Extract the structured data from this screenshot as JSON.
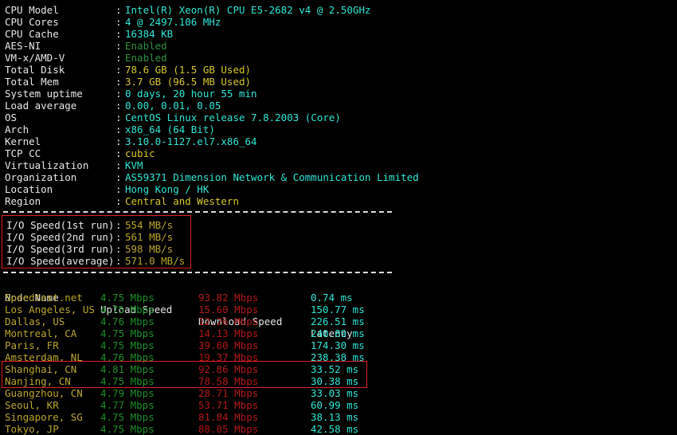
{
  "colors": {
    "background": "#000000",
    "cyan": "#2ee6d6",
    "green": "#3ddc84",
    "dim_green": "#2f8f3f",
    "yellow": "#d6c72b",
    "olive": "#b9a62b",
    "white": "#e8e8e8",
    "red": "#b01818",
    "annotation_red": "#e02020"
  },
  "sysinfo": {
    "rows": [
      {
        "label": "CPU Model",
        "value": "Intel(R) Xeon(R) CPU E5-2682 v4 @ 2.50GHz",
        "color": "c-cyan"
      },
      {
        "label": "CPU Cores",
        "value": "4 @ 2497.106 MHz",
        "color": "c-cyan"
      },
      {
        "label": "CPU Cache",
        "value": "16384 KB",
        "color": "c-cyan"
      },
      {
        "label": "AES-NI",
        "value": "Enabled",
        "color": "c-dimgreen"
      },
      {
        "label": "VM-x/AMD-V",
        "value": "Enabled",
        "color": "c-dimgreen"
      },
      {
        "label": "Total Disk",
        "value": "78.6 GB (1.5 GB Used)",
        "color": "c-yellow"
      },
      {
        "label": "Total Mem",
        "value": "3.7 GB (96.5 MB Used)",
        "color": "c-yellow"
      },
      {
        "label": "System uptime",
        "value": "0 days, 20 hour 55 min",
        "color": "c-cyan"
      },
      {
        "label": "Load average",
        "value": "0.00, 0.01, 0.05",
        "color": "c-cyan"
      },
      {
        "label": "OS",
        "value": "CentOS Linux release 7.8.2003 (Core)",
        "color": "c-cyan"
      },
      {
        "label": "Arch",
        "value": "x86_64 (64 Bit)",
        "color": "c-cyan"
      },
      {
        "label": "Kernel",
        "value": "3.10.0-1127.el7.x86_64",
        "color": "c-cyan"
      },
      {
        "label": "TCP CC",
        "value": "cubic",
        "color": "c-yellow"
      },
      {
        "label": "Virtualization",
        "value": "KVM",
        "color": "c-cyan"
      },
      {
        "label": "Organization",
        "value": "AS59371 Dimension Network & Communication Limited",
        "color": "c-cyan"
      },
      {
        "label": "Location",
        "value": "Hong Kong / HK",
        "color": "c-cyan"
      },
      {
        "label": "Region",
        "value": "Central and Western",
        "color": "c-yellow"
      }
    ],
    "colon": ":"
  },
  "io_speed": {
    "rows": [
      {
        "label": "I/O Speed(1st run)",
        "value": "554 MB/s"
      },
      {
        "label": "I/O Speed(2nd run)",
        "value": "561 MB/s"
      },
      {
        "label": "I/O Speed(3rd run)",
        "value": "598 MB/s"
      },
      {
        "label": "I/O Speed(average)",
        "value": "571.0 MB/s"
      }
    ],
    "colon": ":"
  },
  "speedtest": {
    "headers": {
      "node": "Node Name",
      "upload": "Upload Speed",
      "download": "Download Speed",
      "latency": "Latency"
    },
    "rows": [
      {
        "node": "Speedtest.net",
        "upload": "4.75 Mbps",
        "download": "93.82 Mbps",
        "latency": "0.74 ms"
      },
      {
        "node": "Los Angeles, US",
        "upload": "4.75 Mbps",
        "download": "15.60 Mbps",
        "latency": "150.77 ms"
      },
      {
        "node": "Dallas, US",
        "upload": "4.76 Mbps",
        "download": "12.26 Mbps",
        "latency": "226.51 ms"
      },
      {
        "node": "Montreal, CA",
        "upload": "4.75 Mbps",
        "download": "14.13 Mbps",
        "latency": "240.89 ms"
      },
      {
        "node": "Paris, FR",
        "upload": "4.75 Mbps",
        "download": "39.60 Mbps",
        "latency": "174.30 ms"
      },
      {
        "node": "Amsterdam, NL",
        "upload": "4.76 Mbps",
        "download": "19.37 Mbps",
        "latency": "238.38 ms"
      },
      {
        "node": "Shanghai, CN",
        "upload": "4.81 Mbps",
        "download": "92.86 Mbps",
        "latency": "33.52 ms"
      },
      {
        "node": "Nanjing, CN",
        "upload": "4.75 Mbps",
        "download": "78.58 Mbps",
        "latency": "30.38 ms"
      },
      {
        "node": "Guangzhou, CN",
        "upload": "4.79 Mbps",
        "download": "28.71 Mbps",
        "latency": "33.03 ms"
      },
      {
        "node": "Seoul, KR",
        "upload": "4.77 Mbps",
        "download": "53.71 Mbps",
        "latency": "60.99 ms"
      },
      {
        "node": "Singapore, SG",
        "upload": "4.75 Mbps",
        "download": "81.84 Mbps",
        "latency": "38.13 ms"
      },
      {
        "node": "Tokyo, JP",
        "upload": "4.75 Mbps",
        "download": "88.05 Mbps",
        "latency": "42.58 ms"
      }
    ]
  },
  "annotations": [
    {
      "name": "io-speed-highlight",
      "target": "io_speed"
    },
    {
      "name": "china-nodes-highlight",
      "target": "speedtest.rows.6-7"
    }
  ]
}
